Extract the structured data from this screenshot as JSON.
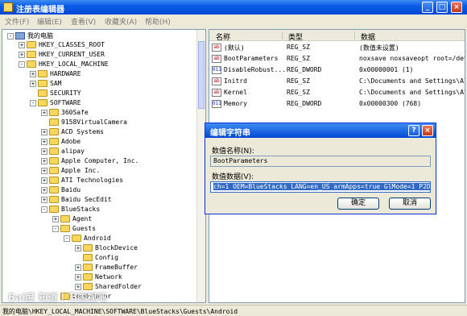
{
  "window": {
    "title": "注册表编辑器",
    "min_glyph": "_",
    "max_glyph": "□",
    "close_glyph": "×"
  },
  "menu": [
    "文件(F)",
    "编辑(E)",
    "查看(V)",
    "收藏夹(A)",
    "帮助(H)"
  ],
  "tree": {
    "nodes": [
      {
        "label": "我的电脑",
        "depth": 0,
        "toggle": "-",
        "icon": "computer-icon"
      },
      {
        "label": "HKEY_CLASSES_ROOT",
        "depth": 1,
        "toggle": "+"
      },
      {
        "label": "HKEY_CURRENT_USER",
        "depth": 1,
        "toggle": "+"
      },
      {
        "label": "HKEY_LOCAL_MACHINE",
        "depth": 1,
        "toggle": "-"
      },
      {
        "label": "HARDWARE",
        "depth": 2,
        "toggle": "+"
      },
      {
        "label": "SAM",
        "depth": 2,
        "toggle": "+"
      },
      {
        "label": "SECURITY",
        "depth": 2,
        "toggle": ""
      },
      {
        "label": "SOFTWARE",
        "depth": 2,
        "toggle": "-"
      },
      {
        "label": "360Safe",
        "depth": 3,
        "toggle": "+"
      },
      {
        "label": "9158VirtualCamera",
        "depth": 3,
        "toggle": ""
      },
      {
        "label": "ACD Systems",
        "depth": 3,
        "toggle": "+"
      },
      {
        "label": "Adobe",
        "depth": 3,
        "toggle": "+"
      },
      {
        "label": "alipay",
        "depth": 3,
        "toggle": "+"
      },
      {
        "label": "Apple Computer, Inc.",
        "depth": 3,
        "toggle": "+"
      },
      {
        "label": "Apple Inc.",
        "depth": 3,
        "toggle": "+"
      },
      {
        "label": "ATI Technologies",
        "depth": 3,
        "toggle": "+"
      },
      {
        "label": "Baidu",
        "depth": 3,
        "toggle": "+"
      },
      {
        "label": "Baidu SecEdit",
        "depth": 3,
        "toggle": "+"
      },
      {
        "label": "BlueStacks",
        "depth": 3,
        "toggle": "-"
      },
      {
        "label": "Agent",
        "depth": 4,
        "toggle": "+"
      },
      {
        "label": "Guests",
        "depth": 4,
        "toggle": "-"
      },
      {
        "label": "Android",
        "depth": 5,
        "toggle": "-"
      },
      {
        "label": "BlockDevice",
        "depth": 6,
        "toggle": "+"
      },
      {
        "label": "Config",
        "depth": 6,
        "toggle": ""
      },
      {
        "label": "FrameBuffer",
        "depth": 6,
        "toggle": "+"
      },
      {
        "label": "Network",
        "depth": 6,
        "toggle": "+"
      },
      {
        "label": "SharedFolder",
        "depth": 6,
        "toggle": "+"
      },
      {
        "label": "LogRotator",
        "depth": 4,
        "toggle": ""
      }
    ]
  },
  "list": {
    "headers": [
      "名称",
      "类型",
      "数据"
    ],
    "rows": [
      {
        "icon": "ab",
        "name": "(默认)",
        "type": "REG_SZ",
        "data": "(数值未设置)"
      },
      {
        "icon": "ab",
        "name": "BootParameters",
        "type": "REG_SZ",
        "data": "noxsave noxsaveopt root=/dev/"
      },
      {
        "icon": "dw",
        "name": "DisableRobust...",
        "type": "REG_DWORD",
        "data": "0x00000001 (1)"
      },
      {
        "icon": "ab",
        "name": "Initrd",
        "type": "REG_SZ",
        "data": "C:\\Documents and Settings\\All"
      },
      {
        "icon": "ab",
        "name": "Kernel",
        "type": "REG_SZ",
        "data": "C:\\Documents and Settings\\All"
      },
      {
        "icon": "dw",
        "name": "Memory",
        "type": "REG_DWORD",
        "data": "0x00000300 (768)"
      }
    ]
  },
  "dialog": {
    "title": "编辑字符串",
    "help_glyph": "?",
    "close_glyph": "×",
    "name_label": "数值名称(N):",
    "name_value": "BootParameters",
    "data_label": "数值数据(V):",
    "data_value": "ch=1 OEM=BlueStacks LANG=en_US armApps=true GlMode=1 P2DM=1",
    "ok_label": "确定",
    "cancel_label": "取消"
  },
  "status": {
    "path": "我的电脑\\HKEY_LOCAL_MACHINE\\SOFTWARE\\BlueStacks\\Guests\\Android"
  },
  "watermark": "Bai度 知道 | 万国视吧"
}
